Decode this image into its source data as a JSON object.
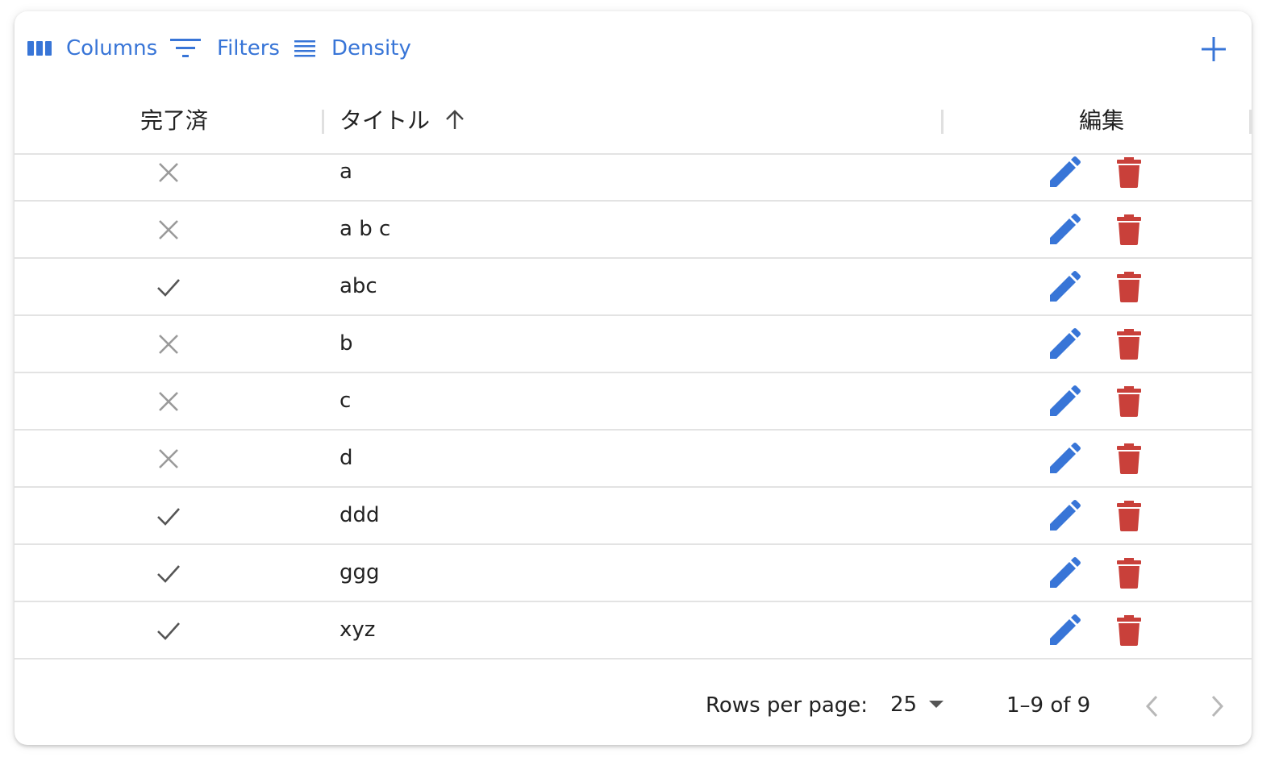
{
  "toolbar": {
    "columns_label": "Columns",
    "filters_label": "Filters",
    "density_label": "Density",
    "add_icon": "plus-icon",
    "accent_color": "#3875d7"
  },
  "table": {
    "headers": {
      "done": "完了済",
      "title": "タイトル",
      "edit": "編集"
    },
    "sort": {
      "column": "title",
      "direction": "ascending",
      "icon": "arrow-up-icon"
    },
    "rows": [
      {
        "done": false,
        "title": "a"
      },
      {
        "done": false,
        "title": "a b c"
      },
      {
        "done": true,
        "title": "abc"
      },
      {
        "done": false,
        "title": "b"
      },
      {
        "done": false,
        "title": "c"
      },
      {
        "done": false,
        "title": "d"
      },
      {
        "done": true,
        "title": "ddd"
      },
      {
        "done": true,
        "title": "ggg"
      },
      {
        "done": true,
        "title": "xyz"
      }
    ],
    "edit_icon": "pencil-icon",
    "delete_icon": "trash-icon",
    "edit_color": "#3875d7",
    "delete_color": "#c9403a"
  },
  "footer": {
    "rows_per_page_label": "Rows per page:",
    "rows_per_page_value": "25",
    "range_text": "1–9 of 9"
  }
}
